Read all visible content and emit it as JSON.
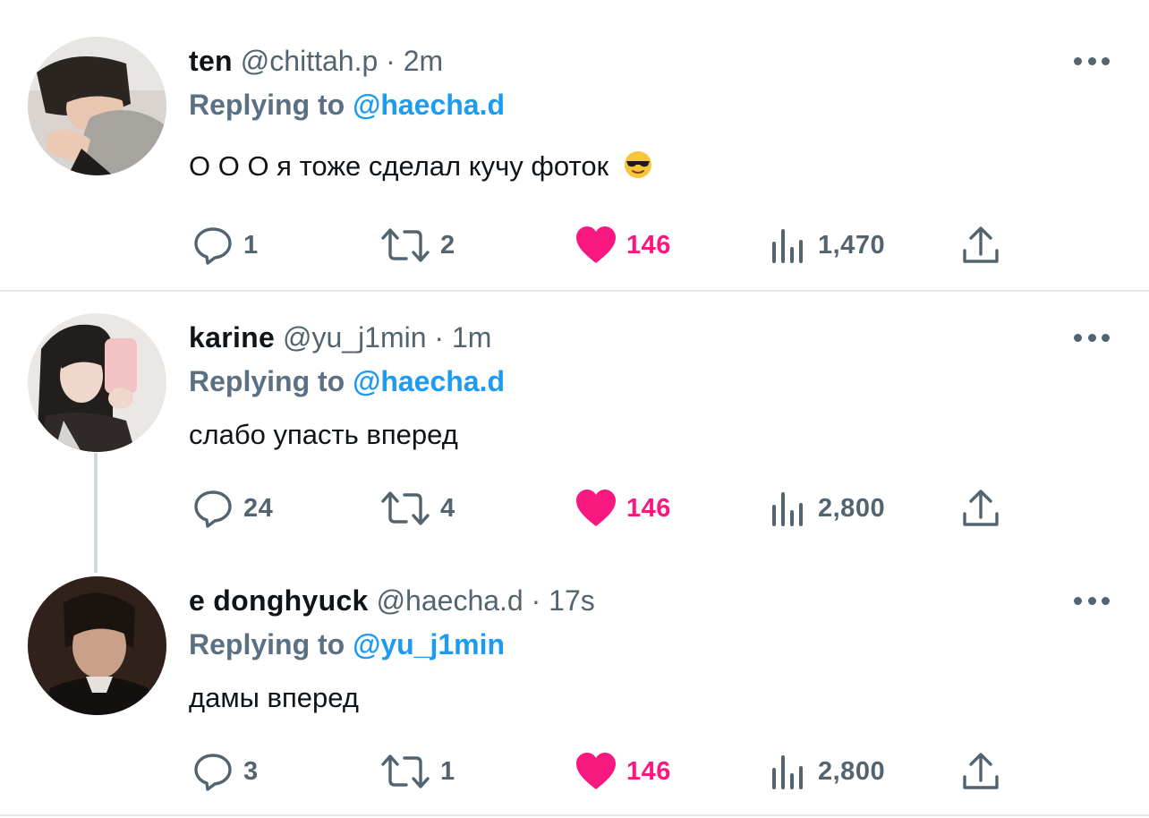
{
  "colors": {
    "accent": "#1d9bf0",
    "like": "#f91880",
    "muted": "#536471"
  },
  "tweets": [
    {
      "display_name": "ten",
      "handle": "@chittah.p",
      "separator": "·",
      "time": "2m",
      "reply_prefix": "Replying to",
      "reply_handle": "@haecha.d",
      "text": "О О О я тоже сделал кучу фоток",
      "emoji": "smiling-face-with-sunglasses",
      "replies": "1",
      "retweets": "2",
      "likes": "146",
      "views": "1,470",
      "liked": true
    },
    {
      "display_name": "karine",
      "handle": "@yu_j1min",
      "separator": "·",
      "time": "1m",
      "reply_prefix": "Replying to",
      "reply_handle": "@haecha.d",
      "text": "слабо упасть вперед",
      "replies": "24",
      "retweets": "4",
      "likes": "146",
      "views": "2,800",
      "liked": true
    },
    {
      "display_name": "e donghyuck",
      "handle": "@haecha.d",
      "separator": "·",
      "time": "17s",
      "reply_prefix": "Replying to",
      "reply_handle": "@yu_j1min",
      "text": "дамы вперед",
      "replies": "3",
      "retweets": "1",
      "likes": "146",
      "views": "2,800",
      "liked": true
    }
  ]
}
